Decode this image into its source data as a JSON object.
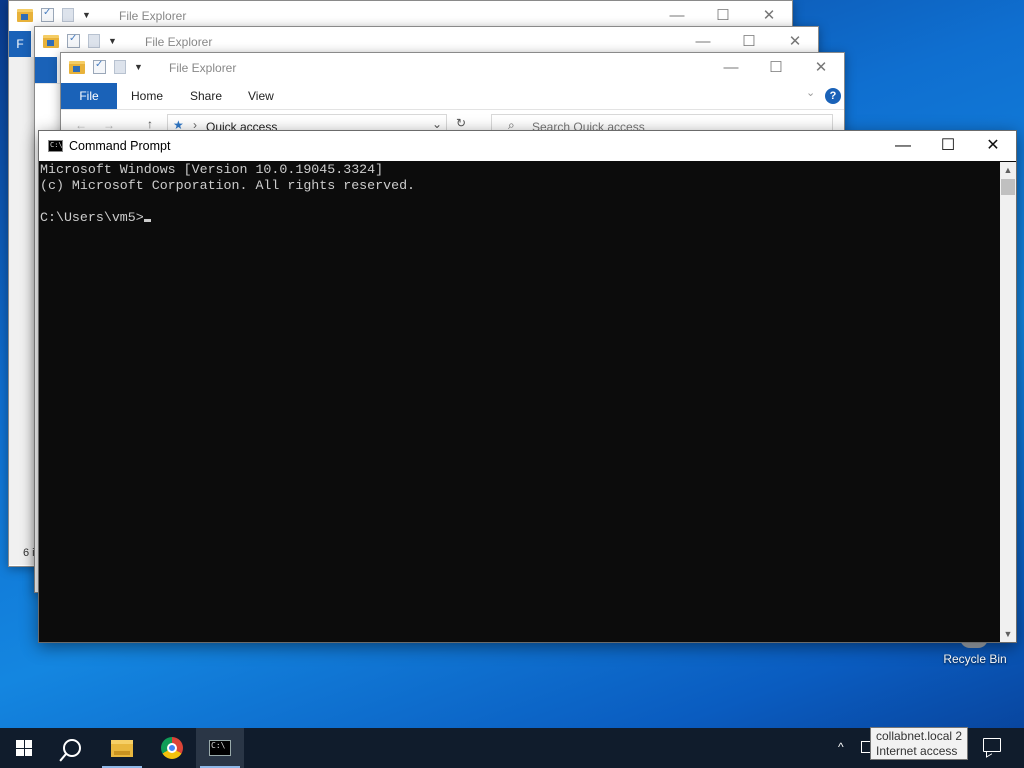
{
  "explorer_windows": [
    {
      "title": "File Explorer",
      "ribbon_file_tab": "F",
      "status_fragment": "6 i"
    },
    {
      "title": "File Explorer"
    },
    {
      "title": "File Explorer",
      "ribbon_tabs": [
        "File",
        "Home",
        "Share",
        "View"
      ],
      "address": "Quick access",
      "search_placeholder": "Search Quick access"
    }
  ],
  "window_controls": {
    "minimize": "—",
    "maximize": "☐",
    "close": "✕"
  },
  "cmd": {
    "title": "Command Prompt",
    "lines": [
      "Microsoft Windows [Version 10.0.19045.3324]",
      "(c) Microsoft Corporation. All rights reserved.",
      "",
      "C:\\Users\\vm5>"
    ]
  },
  "desktop": {
    "recycle_bin_label": "Recycle Bin"
  },
  "taskbar": {
    "apps": [
      "start-icon",
      "search-icon",
      "file-explorer-icon",
      "chrome-icon",
      "command-prompt-icon"
    ],
    "active_app": "command-prompt-icon",
    "tray_overflow": "^"
  },
  "network_tooltip": {
    "line1": "collabnet.local 2",
    "line2": "Internet access"
  },
  "colors": {
    "taskbar": "#101c2c",
    "ribbon_file": "#1a62b8",
    "console_bg": "#0c0c0c",
    "console_fg": "#cccccc"
  }
}
